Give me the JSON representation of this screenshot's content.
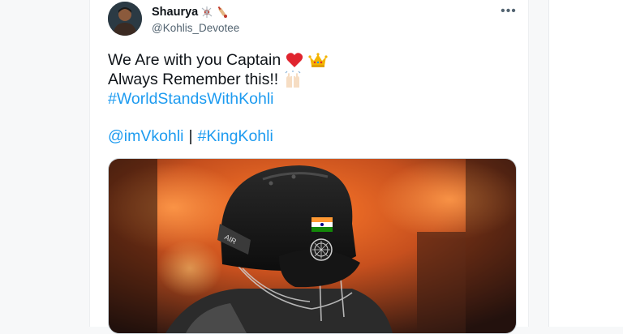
{
  "tweet": {
    "display_name": "Shaurya",
    "name_emojis": [
      "cricket-ball-icon",
      "cricket-bat-icon"
    ],
    "handle": "@Kohlis_Devotee",
    "more_label": "•••",
    "lines": [
      "We Are with you Captain",
      "Always Remember this!!",
      "#WorldStandsWithKohli"
    ],
    "mention": "@imVkohli",
    "separator": "|",
    "hashtag2": "#KingKohli",
    "line_emojis": [
      "red-heart-icon",
      "crown-icon",
      "raised-hands-icon"
    ],
    "media_description_icon": "cricket-helmet-photo"
  },
  "colors": {
    "link": "#1d9bf0",
    "text": "#0f1419",
    "muted": "#536471",
    "helmet_flag_saffron": "#ff9933",
    "helmet_flag_green": "#138808"
  }
}
